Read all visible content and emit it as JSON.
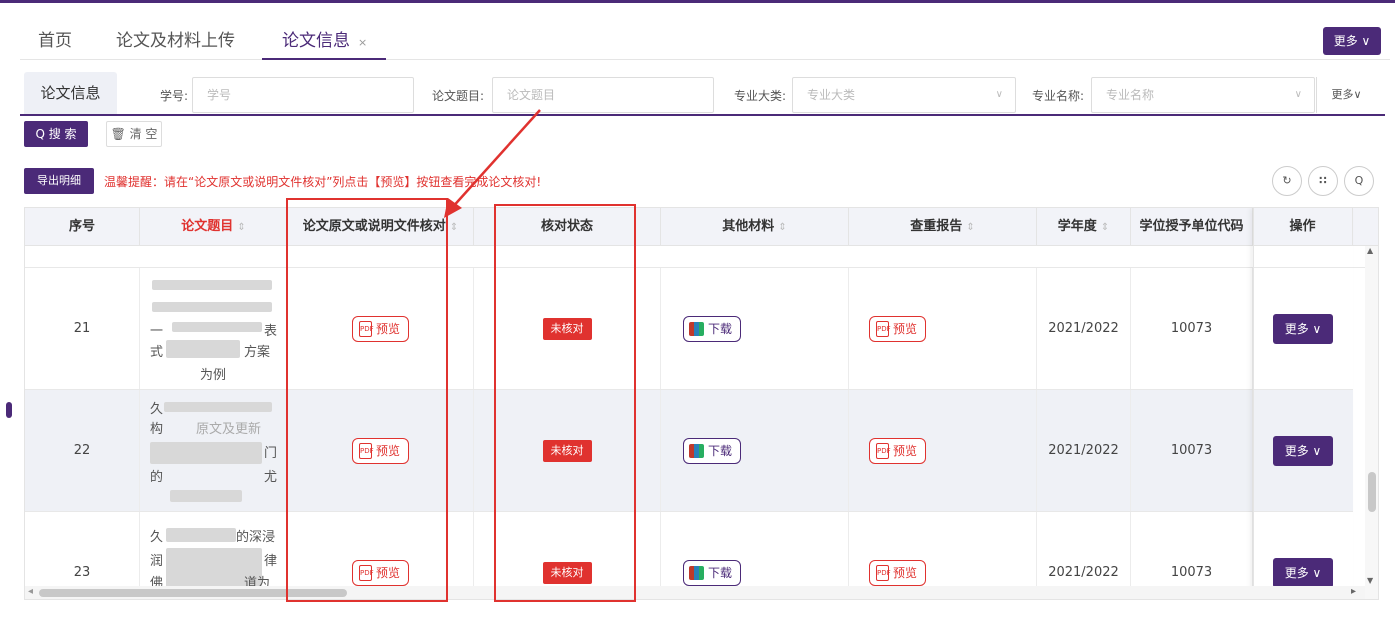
{
  "nav": {
    "tabs": [
      "首页",
      "论文及材料上传",
      "论文信息"
    ],
    "close_icon": "×",
    "more_label": "更多 ∨"
  },
  "filter": {
    "tab_label": "论文信息",
    "fields": [
      {
        "label": "学号:",
        "placeholder": "学号"
      },
      {
        "label": "论文题目:",
        "placeholder": "论文题目"
      },
      {
        "label": "专业大类:",
        "placeholder": "专业大类"
      },
      {
        "label": "专业名称:",
        "placeholder": "专业名称"
      }
    ],
    "more_label": "更多∨"
  },
  "actions": {
    "search_label": "Q 搜 索",
    "clear_label": "🗑 清 空",
    "export_label": "导出明细",
    "tip": "温馨提醒：请在“论文原文或说明文件核对”列点击【预览】按钮查看完成论文核对!"
  },
  "table": {
    "headers": [
      "序号",
      "论文题目",
      "论文原文或说明文件核对",
      "核对状态",
      "其他材料",
      "查重报告",
      "学年度",
      "学位授予单位代码",
      "操作"
    ],
    "rows": [
      {
        "no": "21",
        "title_fragments": [
          "一",
          "表",
          "式",
          "方案",
          "为例"
        ],
        "preview": "预览",
        "status": "未核对",
        "download": "下载",
        "report": "预览",
        "year": "2021/2022",
        "code": "10073",
        "more": "更多 ∨"
      },
      {
        "no": "22",
        "title_fragments": [
          "久",
          "构",
          "原文及更新",
          "门",
          "的",
          "尤"
        ],
        "preview": "预览",
        "status": "未核对",
        "download": "下载",
        "report": "预览",
        "year": "2021/2022",
        "code": "10073",
        "more": "更多 ∨"
      },
      {
        "no": "23",
        "title_fragments": [
          "久",
          "的深浸",
          "润",
          "律",
          "佛",
          "道为"
        ],
        "preview": "预览",
        "status": "未核对",
        "download": "下载",
        "report": "预览",
        "year": "2021/2022",
        "code": "10073",
        "more": "更多 ∨"
      }
    ]
  },
  "icons": {
    "refresh": "↻",
    "grid": "∷",
    "search": "Q",
    "pdf": "PDF",
    "scroll_up": "▲",
    "scroll_down": "▼",
    "scroll_left": "◂",
    "scroll_right": "▸"
  },
  "colors": {
    "accent": "#4b2a78",
    "alert": "#e0322f"
  }
}
